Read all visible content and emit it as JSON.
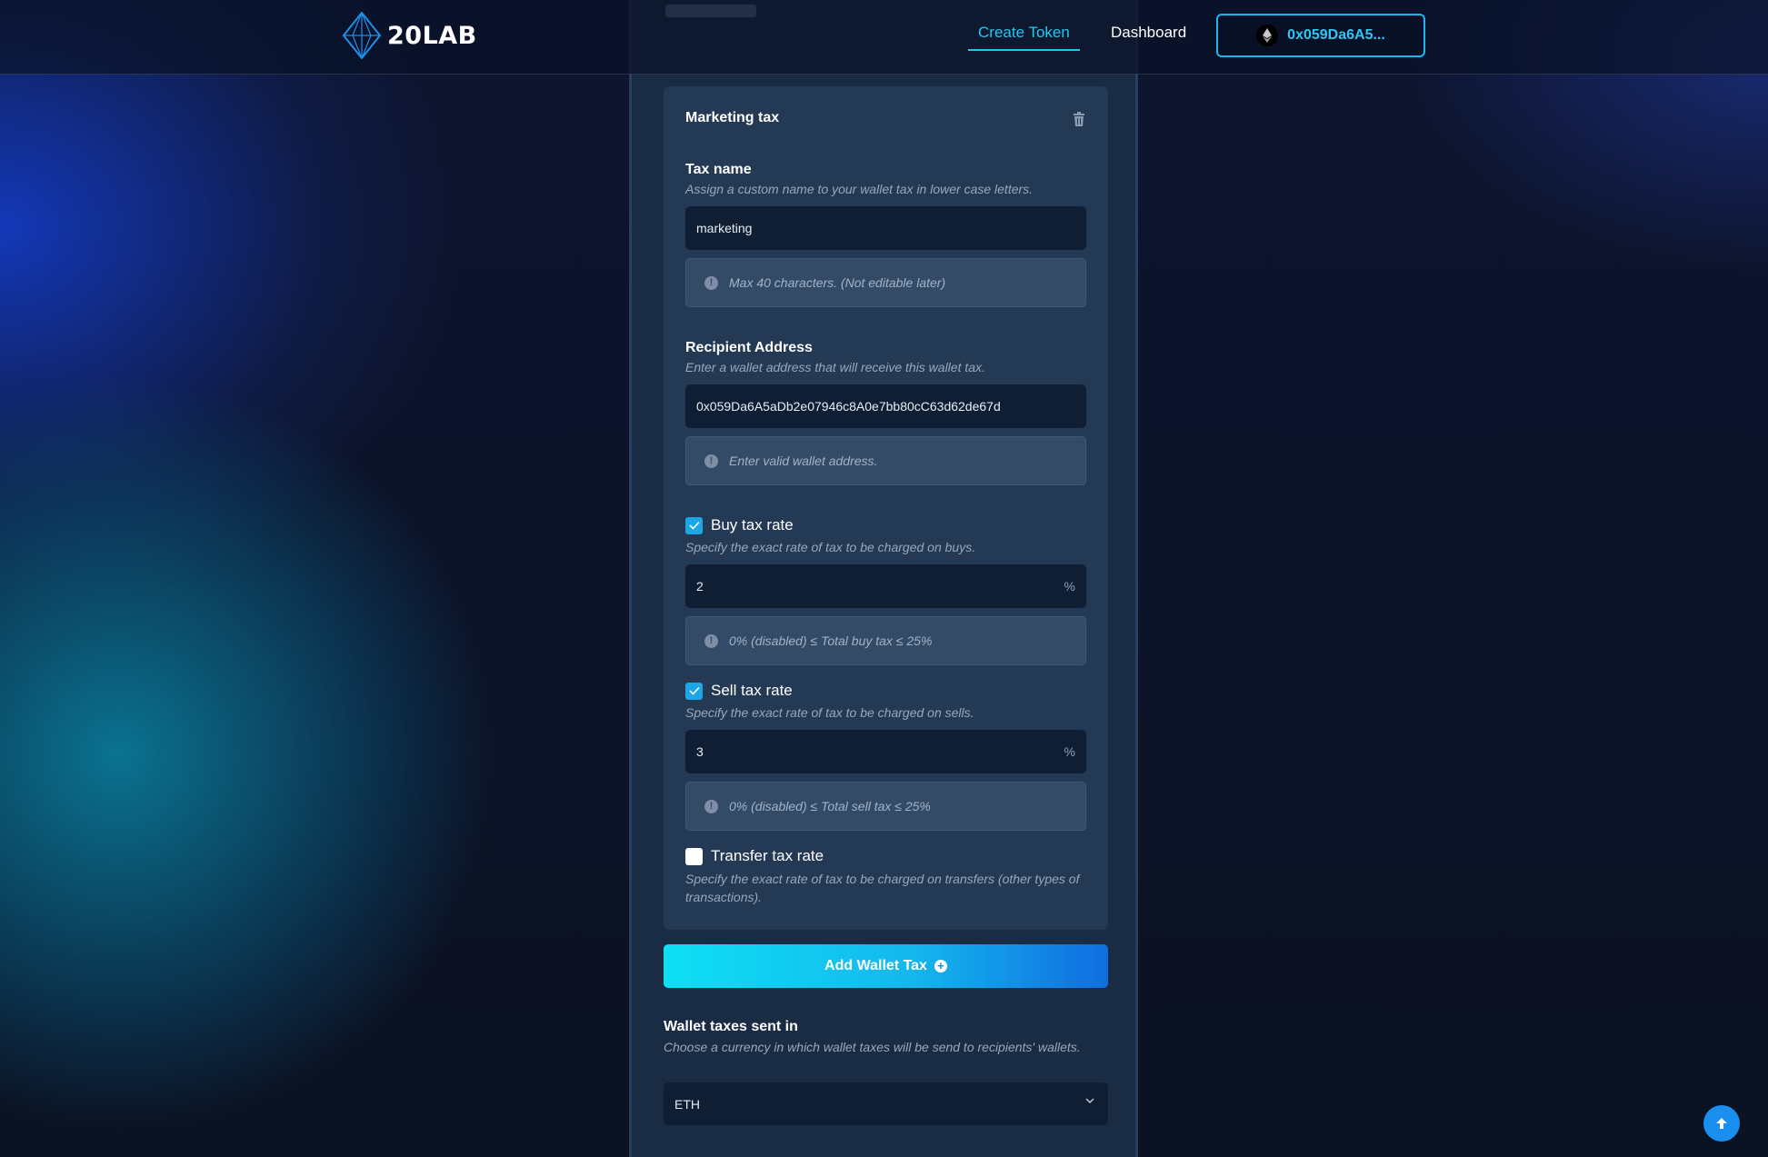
{
  "header": {
    "logo_text": "20LAB",
    "nav": {
      "create_token": "Create Token",
      "dashboard": "Dashboard"
    },
    "wallet_label": "0x059Da6A5..."
  },
  "tax_card": {
    "title": "Marketing tax",
    "tax_name": {
      "label": "Tax name",
      "help": "Assign a custom name to your wallet tax in lower case letters.",
      "value": "marketing",
      "hint": "Max 40 characters. (Not editable later)"
    },
    "recipient": {
      "label": "Recipient Address",
      "help": "Enter a wallet address that will receive this wallet tax.",
      "value": "0x059Da6A5aDb2e07946c8A0e7bb80cC63d62de67d",
      "hint": "Enter valid wallet address."
    },
    "buy_tax": {
      "label": "Buy tax rate",
      "checked": true,
      "help": "Specify the exact rate of tax to be charged on buys.",
      "value": "2",
      "suffix": "%",
      "hint": "0% (disabled) ≤ Total buy tax ≤ 25%"
    },
    "sell_tax": {
      "label": "Sell tax rate",
      "checked": true,
      "help": "Specify the exact rate of tax to be charged on sells.",
      "value": "3",
      "suffix": "%",
      "hint": "0% (disabled) ≤ Total sell tax ≤ 25%"
    },
    "transfer_tax": {
      "label": "Transfer tax rate",
      "checked": false,
      "help": "Specify the exact rate of tax to be charged on transfers (other types of transactions)."
    }
  },
  "add_button": {
    "label": "Add Wallet Tax"
  },
  "currency": {
    "label": "Wallet taxes sent in",
    "help": "Choose a currency in which wallet taxes will be send to recipients' wallets.",
    "selected": "ETH"
  },
  "colors": {
    "accent": "#1fc8f0",
    "checkbox": "#1da6e6",
    "card": "#243954",
    "panel": "#1a2b44"
  },
  "icons": [
    "logo-icon",
    "ethereum-icon",
    "trash-icon",
    "info-icon",
    "check-icon",
    "plus-circle-icon",
    "chevron-down-icon",
    "arrow-up-icon"
  ]
}
